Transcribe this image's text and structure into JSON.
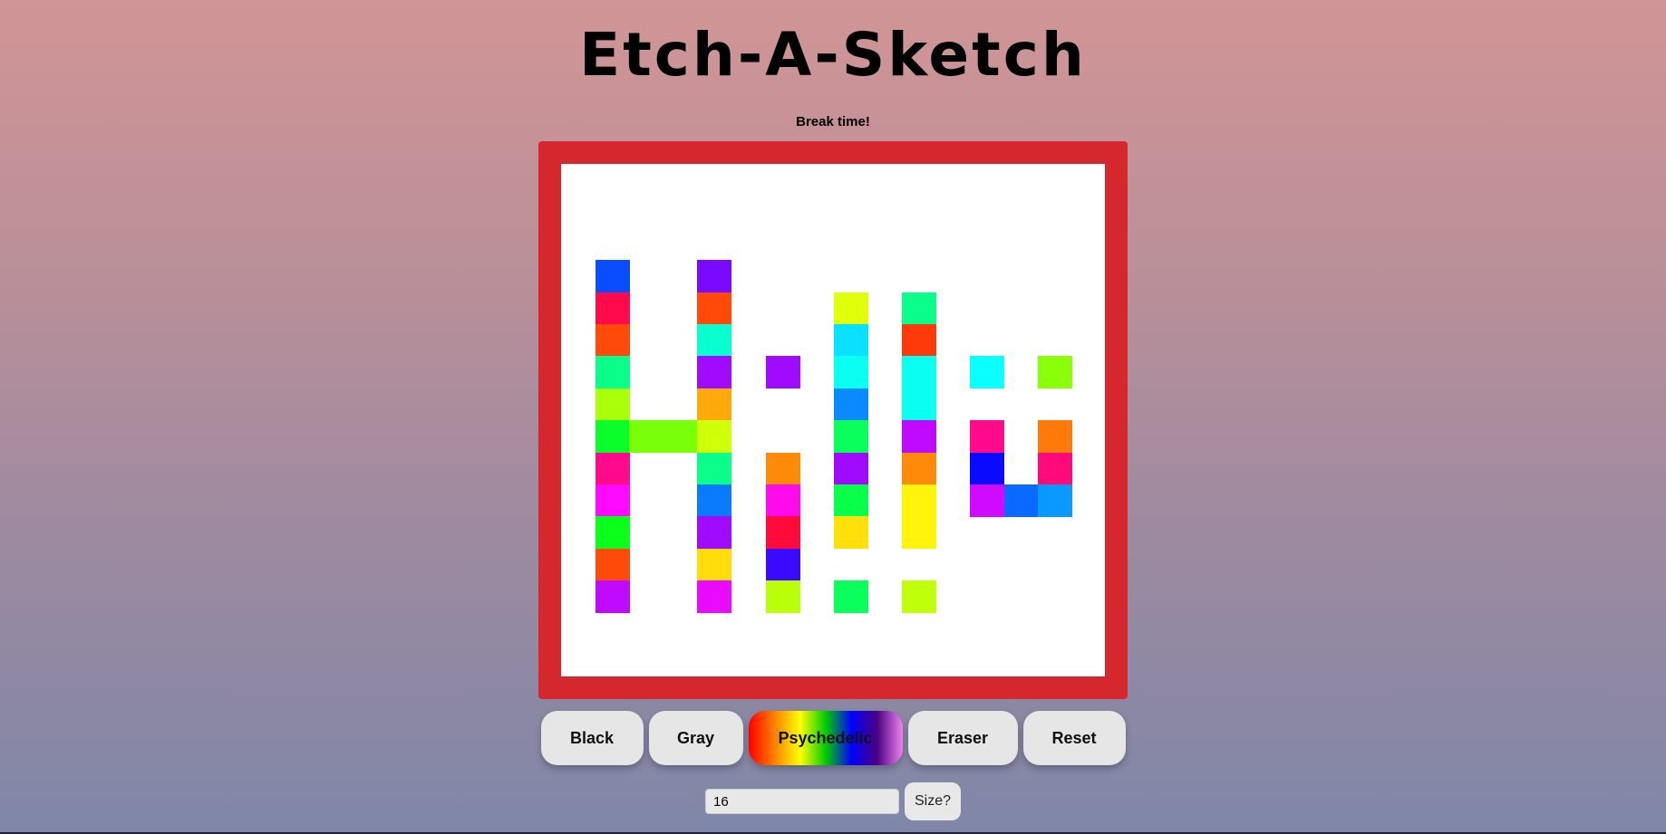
{
  "title": "Etch-A-Sketch",
  "subtitle": "Break time!",
  "buttons": {
    "black": "Black",
    "gray": "Gray",
    "psychedelic": "Psychedelic",
    "eraser": "Eraser",
    "reset": "Reset"
  },
  "size_input": {
    "value": "16"
  },
  "size_button": "Size?",
  "colors": {
    "frame": "#d4282e",
    "canvas": "#ffffff"
  },
  "grid": {
    "size": 16,
    "painted_cells": [
      {
        "col": 1,
        "row": 3,
        "color": "#0a4cff"
      },
      {
        "col": 1,
        "row": 4,
        "color": "#ff0a4a"
      },
      {
        "col": 1,
        "row": 5,
        "color": "#ff4a0a"
      },
      {
        "col": 1,
        "row": 6,
        "color": "#0aff8a"
      },
      {
        "col": 1,
        "row": 7,
        "color": "#aaff0a"
      },
      {
        "col": 1,
        "row": 8,
        "color": "#0aff2a"
      },
      {
        "col": 1,
        "row": 9,
        "color": "#ff0a8a"
      },
      {
        "col": 1,
        "row": 10,
        "color": "#ff0aff"
      },
      {
        "col": 1,
        "row": 11,
        "color": "#0aff1a"
      },
      {
        "col": 1,
        "row": 12,
        "color": "#ff4a0a"
      },
      {
        "col": 1,
        "row": 13,
        "color": "#c00aff"
      },
      {
        "col": 2,
        "row": 8,
        "color": "#7aff0a"
      },
      {
        "col": 3,
        "row": 8,
        "color": "#7aff0a"
      },
      {
        "col": 4,
        "row": 3,
        "color": "#7a0aff"
      },
      {
        "col": 4,
        "row": 4,
        "color": "#ff4a0a"
      },
      {
        "col": 4,
        "row": 5,
        "color": "#0affd0"
      },
      {
        "col": 4,
        "row": 6,
        "color": "#a00aff"
      },
      {
        "col": 4,
        "row": 7,
        "color": "#ffaa0a"
      },
      {
        "col": 4,
        "row": 8,
        "color": "#d0ff0a"
      },
      {
        "col": 4,
        "row": 9,
        "color": "#0aff8a"
      },
      {
        "col": 4,
        "row": 10,
        "color": "#0a7aff"
      },
      {
        "col": 4,
        "row": 11,
        "color": "#a00aff"
      },
      {
        "col": 4,
        "row": 12,
        "color": "#ffdd0a"
      },
      {
        "col": 4,
        "row": 13,
        "color": "#ea0aff"
      },
      {
        "col": 6,
        "row": 6,
        "color": "#a00aff"
      },
      {
        "col": 6,
        "row": 9,
        "color": "#ff8a0a"
      },
      {
        "col": 6,
        "row": 10,
        "color": "#ff0aea"
      },
      {
        "col": 6,
        "row": 11,
        "color": "#ff0a3a"
      },
      {
        "col": 6,
        "row": 12,
        "color": "#3a0aff"
      },
      {
        "col": 6,
        "row": 13,
        "color": "#baff0a"
      },
      {
        "col": 8,
        "row": 4,
        "color": "#e0ff0a"
      },
      {
        "col": 8,
        "row": 5,
        "color": "#0ae0ff"
      },
      {
        "col": 8,
        "row": 6,
        "color": "#0afff0"
      },
      {
        "col": 8,
        "row": 7,
        "color": "#0a8aff"
      },
      {
        "col": 8,
        "row": 8,
        "color": "#0aff5a"
      },
      {
        "col": 8,
        "row": 9,
        "color": "#a00aff"
      },
      {
        "col": 8,
        "row": 10,
        "color": "#0aff4a"
      },
      {
        "col": 8,
        "row": 11,
        "color": "#ffe00a"
      },
      {
        "col": 8,
        "row": 13,
        "color": "#0aff5a"
      },
      {
        "col": 10,
        "row": 4,
        "color": "#0aff8a"
      },
      {
        "col": 10,
        "row": 5,
        "color": "#ff3a0a"
      },
      {
        "col": 10,
        "row": 6,
        "color": "#0afff0"
      },
      {
        "col": 10,
        "row": 7,
        "color": "#0afff0"
      },
      {
        "col": 10,
        "row": 8,
        "color": "#c00aff"
      },
      {
        "col": 10,
        "row": 9,
        "color": "#ff8a0a"
      },
      {
        "col": 10,
        "row": 10,
        "color": "#fff50a"
      },
      {
        "col": 10,
        "row": 11,
        "color": "#fff50a"
      },
      {
        "col": 10,
        "row": 13,
        "color": "#c0ff0a"
      },
      {
        "col": 12,
        "row": 6,
        "color": "#0affff"
      },
      {
        "col": 12,
        "row": 8,
        "color": "#ff0a8a"
      },
      {
        "col": 12,
        "row": 9,
        "color": "#0a0aff"
      },
      {
        "col": 12,
        "row": 10,
        "color": "#d00aff"
      },
      {
        "col": 13,
        "row": 10,
        "color": "#0a6aff"
      },
      {
        "col": 14,
        "row": 6,
        "color": "#8aff0a"
      },
      {
        "col": 14,
        "row": 8,
        "color": "#ff7a0a"
      },
      {
        "col": 14,
        "row": 9,
        "color": "#ff0a7a"
      },
      {
        "col": 14,
        "row": 10,
        "color": "#0a9aff"
      }
    ]
  }
}
